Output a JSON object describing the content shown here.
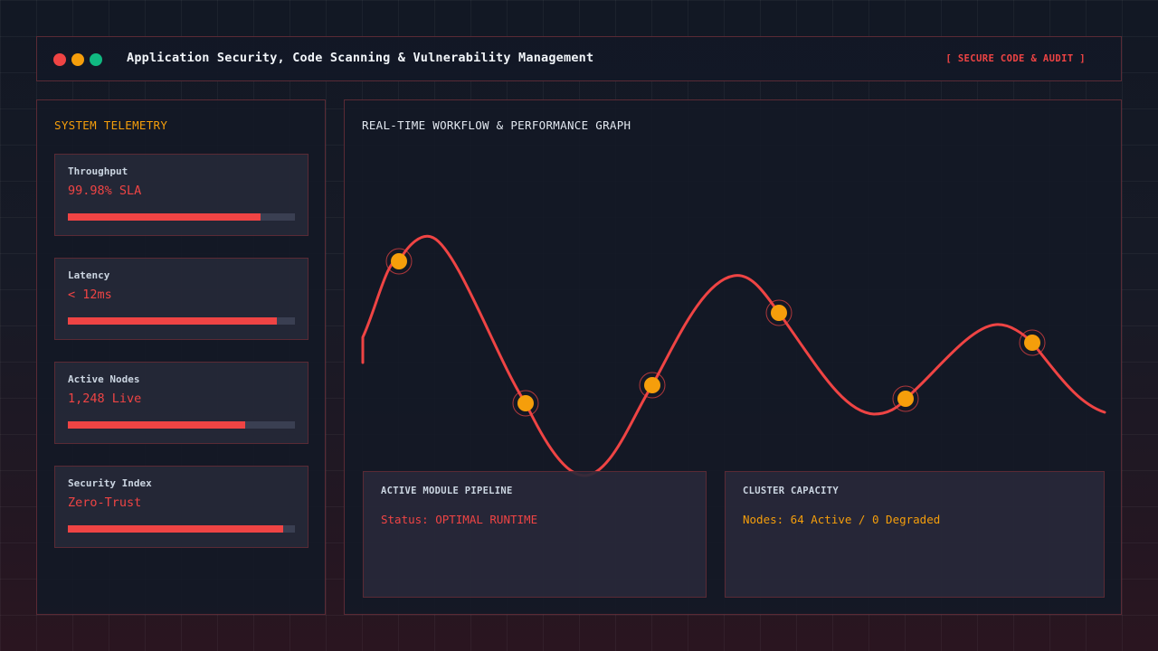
{
  "window": {
    "title": "Application Security, Code Scanning & Vulnerability Management",
    "badge": "[ SECURE CODE & AUDIT ]",
    "controls": [
      "close",
      "minimize",
      "maximize"
    ]
  },
  "colors": {
    "accent": "#ef4444",
    "warning": "#f59e0b",
    "success": "#10b981",
    "node": "#f59e0b"
  },
  "telemetry": {
    "title": "SYSTEM TELEMETRY",
    "metrics": [
      {
        "label": "Throughput",
        "value": "99.98% SLA",
        "progress": 0.85
      },
      {
        "label": "Latency",
        "value": "< 12ms",
        "progress": 0.92
      },
      {
        "label": "Active Nodes",
        "value": "1,248 Live",
        "progress": 0.78
      },
      {
        "label": "Security Index",
        "value": "Zero-Trust",
        "progress": 0.95
      }
    ]
  },
  "graph": {
    "title": "REAL-TIME WORKFLOW & PERFORMANCE GRAPH"
  },
  "pipeline": {
    "title": "ACTIVE MODULE PIPELINE",
    "status": "Status: OPTIMAL RUNTIME"
  },
  "capacity": {
    "title": "CLUSTER CAPACITY",
    "status": "Nodes: 64 Active / 0 Degraded"
  }
}
